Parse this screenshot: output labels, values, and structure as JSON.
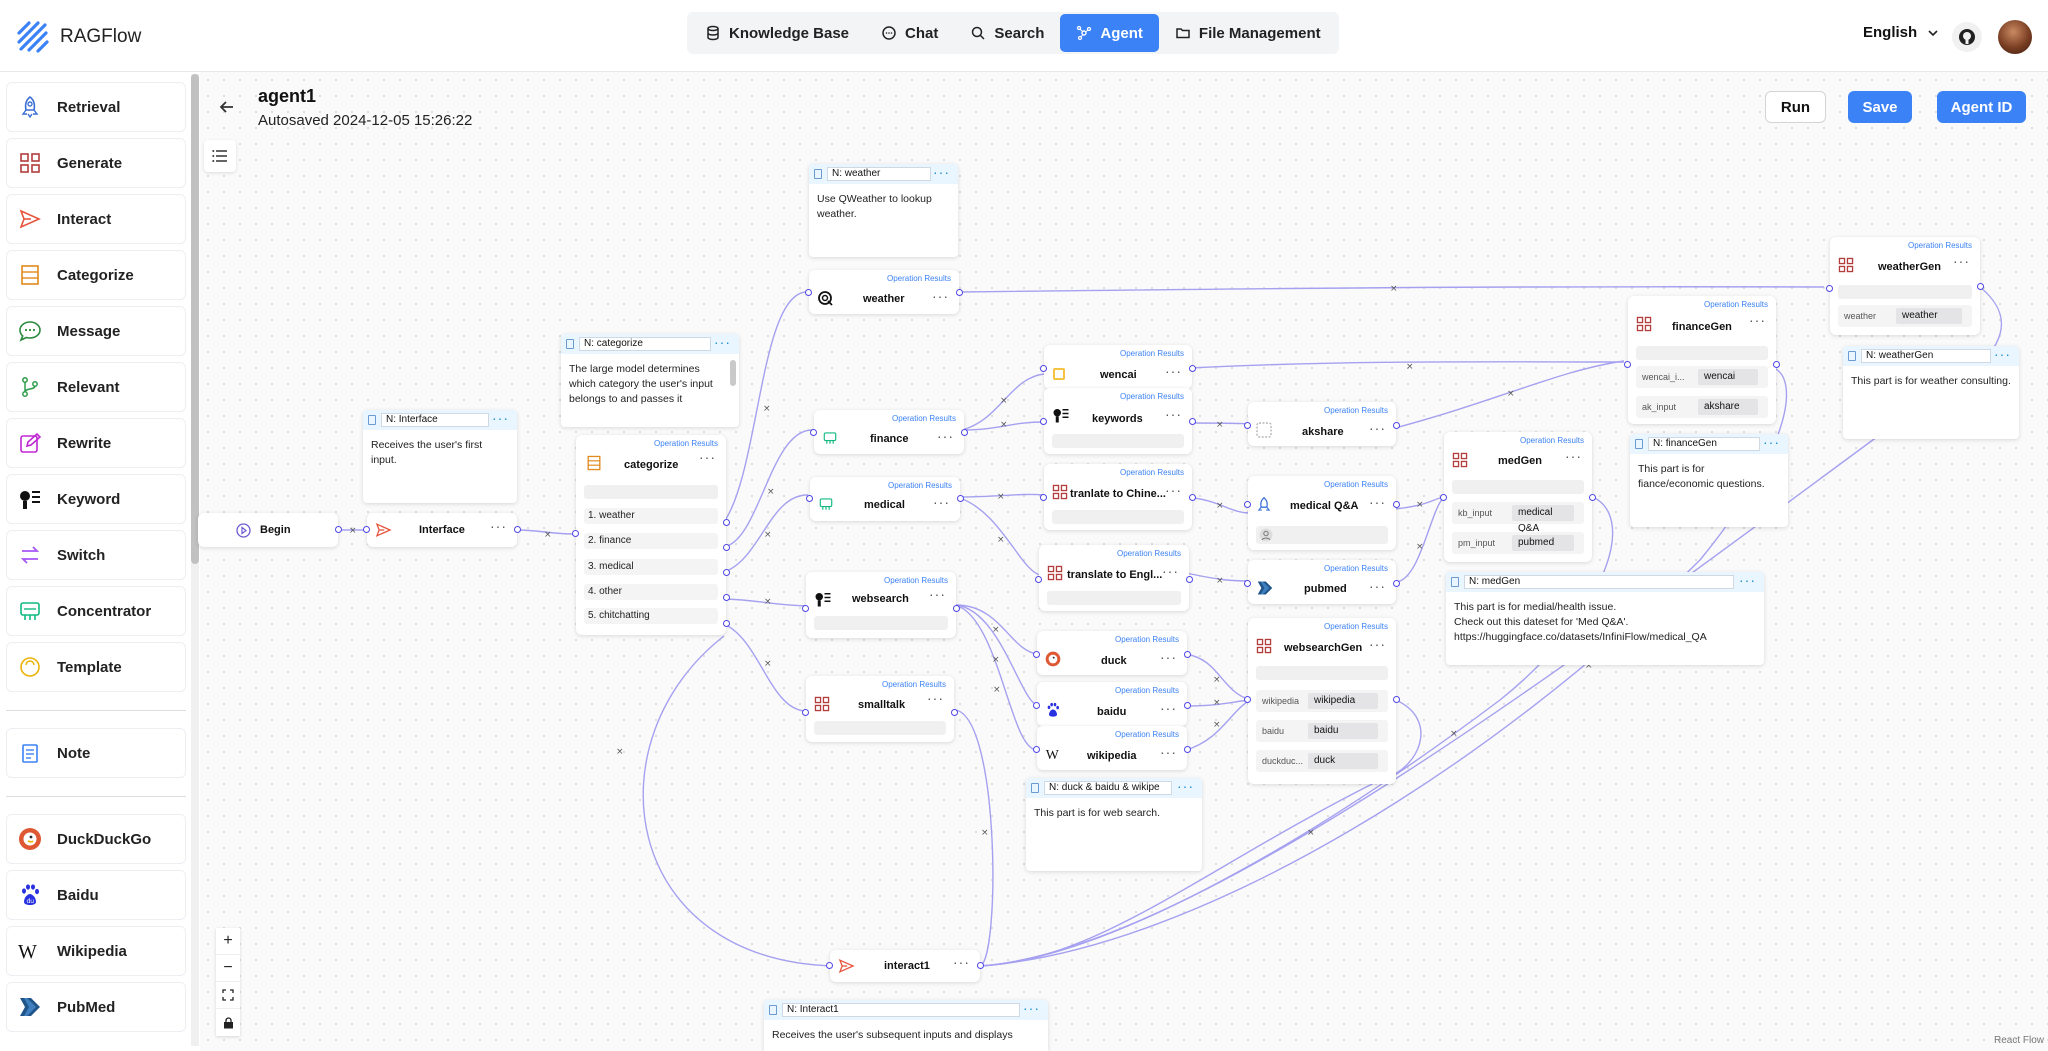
{
  "app": {
    "name": "RAGFlow"
  },
  "nav": {
    "items": [
      {
        "label": "Knowledge Base",
        "icon": "database-icon"
      },
      {
        "label": "Chat",
        "icon": "chat-icon"
      },
      {
        "label": "Search",
        "icon": "search-icon"
      },
      {
        "label": "Agent",
        "icon": "agent-icon",
        "active": true
      },
      {
        "label": "File Management",
        "icon": "folder-icon"
      }
    ]
  },
  "header": {
    "language": "English"
  },
  "sidebar": {
    "items": [
      {
        "label": "Retrieval",
        "icon": "rocket-icon",
        "color": "#3b6fd6"
      },
      {
        "label": "Generate",
        "icon": "generate-icon",
        "color": "#b33d3d"
      },
      {
        "label": "Interact",
        "icon": "send-icon",
        "color": "#e8553e"
      },
      {
        "label": "Categorize",
        "icon": "categorize-icon",
        "color": "#e08a1e"
      },
      {
        "label": "Message",
        "icon": "message-icon",
        "color": "#2b8a3e"
      },
      {
        "label": "Relevant",
        "icon": "relevant-icon",
        "color": "#2e9d4b"
      },
      {
        "label": "Rewrite",
        "icon": "rewrite-icon",
        "color": "#c026d3"
      },
      {
        "label": "Keyword",
        "icon": "keyword-icon",
        "color": "#111111"
      },
      {
        "label": "Switch",
        "icon": "switch-icon",
        "color": "#a855f7"
      },
      {
        "label": "Concentrator",
        "icon": "concentrator-icon",
        "color": "#10b981"
      },
      {
        "label": "Template",
        "icon": "template-icon",
        "color": "#eab308"
      }
    ],
    "note": {
      "label": "Note",
      "icon": "note-icon"
    },
    "tools": [
      {
        "label": "DuckDuckGo",
        "icon": "duckduckgo-icon"
      },
      {
        "label": "Baidu",
        "icon": "baidu-icon"
      },
      {
        "label": "Wikipedia",
        "icon": "wikipedia-icon"
      },
      {
        "label": "PubMed",
        "icon": "pubmed-icon"
      }
    ]
  },
  "canvas": {
    "title": "agent1",
    "autosaved": "Autosaved 2024-12-05 15:26:22",
    "run_label": "Run",
    "save_label": "Save",
    "agent_id_label": "Agent ID",
    "op_results": "Operation Results",
    "attribution": "React Flow"
  },
  "nodes": {
    "begin": "Begin",
    "interface": "Interface",
    "categorize": "categorize",
    "categories": [
      "1. weather",
      "2. finance",
      "3. medical",
      "4. other",
      "5. chitchatting"
    ],
    "weather": "weather",
    "finance": "finance",
    "medical": "medical",
    "websearch": "websearch",
    "smalltalk": "smalltalk",
    "wencai": "wencai",
    "keywords": "keywords",
    "akshare": "akshare",
    "translate_cn": "tranlate to Chine...",
    "translate_en": "translate to Engl...",
    "medical_qa": "medical Q&A",
    "pubmed": "pubmed",
    "duck": "duck",
    "baidu": "baidu",
    "wikipedia": "wikipedia",
    "websearchGen": "websearchGen",
    "medGen": "medGen",
    "financeGen": "financeGen",
    "weatherGen": "weatherGen",
    "interact1": "interact1",
    "websearchGen_kv": [
      {
        "k": "wikipedia",
        "v": "wikipedia"
      },
      {
        "k": "baidu",
        "v": "baidu"
      },
      {
        "k": "duckduc...",
        "v": "duck"
      }
    ],
    "medGen_kv": [
      {
        "k": "kb_input",
        "v": "medical Q&A"
      },
      {
        "k": "pm_input",
        "v": "pubmed"
      }
    ],
    "financeGen_kv": [
      {
        "k": "wencai_i...",
        "v": "wencai"
      },
      {
        "k": "ak_input",
        "v": "akshare"
      }
    ],
    "weatherGen_kv": [
      {
        "k": "weather",
        "v": "weather"
      }
    ]
  },
  "notes": {
    "weather": {
      "name": "N: weather",
      "text": "Use QWeather to lookup weather."
    },
    "categorize": {
      "name": "N: categorize",
      "text": "The large model determines which category the user's input belongs to and passes it"
    },
    "interface": {
      "name": "N: Interface",
      "text": "Receives the user's first input."
    },
    "duck": {
      "name": "N: duck & baidu & wikipe",
      "text": "This part is for web search."
    },
    "financeGen": {
      "name": "N: financeGen",
      "text": "This part is for fiance/economic questions."
    },
    "weatherGen": {
      "name": "N: weatherGen",
      "text": "This part is for weather consulting."
    },
    "medGen": {
      "name": "N: medGen",
      "text": "This part is for medial/health issue.\nCheck out this dateset for 'Med Q&A'.\nhttps://huggingface.co/datasets/InfiniFlow/medical_QA"
    },
    "interact1": {
      "name": "N: Interact1",
      "text": "Receives the user's subsequent inputs and displays"
    }
  }
}
